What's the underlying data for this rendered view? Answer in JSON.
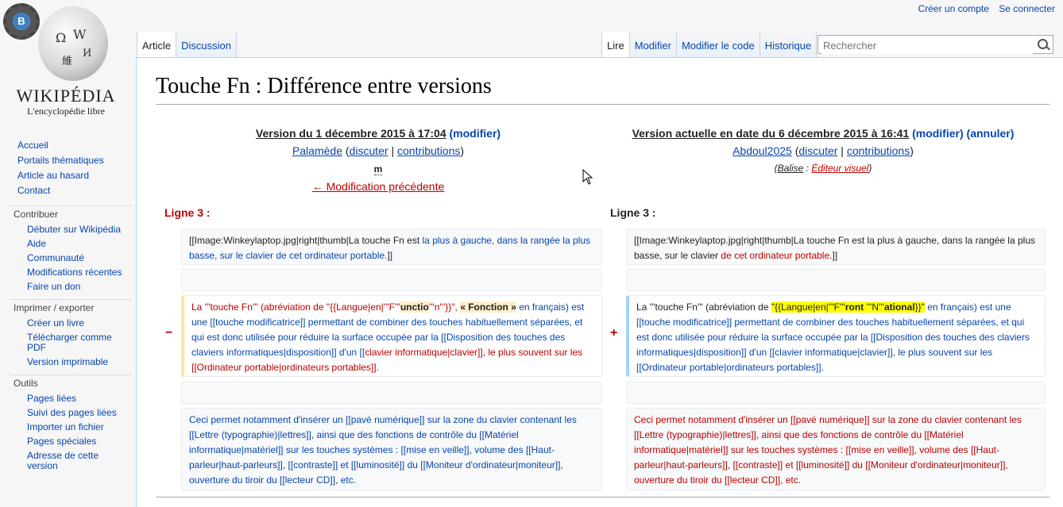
{
  "personal": {
    "create_account": "Créer un compte",
    "login": "Se connecter"
  },
  "logo": {
    "wordmark": "WIKIPÉDIA",
    "tagline": "L'encyclopédie libre",
    "badge_letter": "B"
  },
  "sidebar": {
    "main": [
      "Accueil",
      "Portails thématiques",
      "Article au hasard",
      "Contact"
    ],
    "contribute": {
      "heading": "Contribuer",
      "items": [
        "Débuter sur Wikipédia",
        "Aide",
        "Communauté",
        "Modifications récentes",
        "Faire un don"
      ]
    },
    "print": {
      "heading": "Imprimer / exporter",
      "items": [
        "Créer un livre",
        "Télécharger comme PDF",
        "Version imprimable"
      ]
    },
    "tools": {
      "heading": "Outils",
      "items": [
        "Pages liées",
        "Suivi des pages liées",
        "Importer un fichier",
        "Pages spéciales",
        "Adresse de cette version"
      ]
    }
  },
  "tabs": {
    "article": "Article",
    "discussion": "Discussion",
    "read": "Lire",
    "edit": "Modifier",
    "edit_source": "Modifier le code",
    "history": "Historique"
  },
  "search": {
    "placeholder": "Rechercher"
  },
  "page_title": "Touche Fn : Différence entre versions",
  "left_version": {
    "heading": "Version du 1 décembre 2015 à 17:04",
    "modify": "(modifier)",
    "user": "Palamède",
    "talk": "discuter",
    "contribs": "contributions",
    "minor": "m",
    "prev": "← Modification précédente"
  },
  "right_version": {
    "heading": "Version actuelle en date du 6 décembre 2015 à 16:41",
    "modify": "(modifier)",
    "undo": "(annuler)",
    "user": "Abdoul2025",
    "talk": "discuter",
    "contribs": "contributions",
    "tag_label": "Balise",
    "tag_value": "Éditeur visuel"
  },
  "line_label": "Ligne 3 :",
  "diff": {
    "row1_left_a": "[[Image:Winkeylaptop.jpg|right|thumb|La touche Fn est ",
    "row1_left_b": "la plus à gauche, dans la rangée la plus basse, sur le clavier de cet ordinateur portable.",
    "row1_left_c": "]]",
    "row1_right_a": "[[Image:Winkeylaptop.jpg|right|thumb|La touche Fn est la plus à gauche, dans la rangée la plus basse, sur le clavier ",
    "row1_right_b": "de cet ordinateur portable.",
    "row1_right_c": "]]",
    "row3_left": [
      "La '''touche Fn''' (abréviation de \"{{Langue|en|'''F'''",
      "unctio",
      "'''n'''}}\", ",
      "« Fonction »",
      " en français) est une [[touche modificatrice]] permettant de combiner des touches habituellement séparées, et qui est donc utilisée pour réduire la surface occupée par la [[Disposition des touches des claviers informatiques|disposition]] d'un [[",
      "clavier informatique|clavier",
      "]], le plus souvent sur les [[Ordinateur portable|ordinateurs portables]]."
    ],
    "row3_right": [
      "La '''touche Fn''' (abréviation de ",
      "\"{{Langue|en|'''F'''",
      "ront ",
      "'''N'''",
      "ational",
      "}}\"",
      " en français) est une [[touche modificatrice]] permettant de combiner des touches habituellement séparées, et qui est donc utilisée pour réduire la surface occupée par la [[Disposition des touches des claviers informatiques|disposition]] d'un [[clavier informatique|clavier]], le plus souvent sur les [[Ordinateur portable|ordinateurs portables]]."
    ],
    "row5_left": "Ceci permet notamment d'insérer un [[pavé numérique]] sur la zone du clavier contenant les [[Lettre (typographie)|lettres]], ainsi que des fonctions de contrôle du [[Matériel informatique|matériel]] sur les touches systèmes : [[mise en veille]], volume des [[Haut-parleur|haut-parleurs]], [[contraste]] et [[luminosité]] du [[Moniteur d'ordinateur|moniteur]], ouverture du tiroir du [[lecteur CD]], etc.",
    "row5_right": "Ceci permet notamment d'insérer un [[pavé numérique]] sur la zone du clavier contenant les [[Lettre (typographie)|lettres]], ainsi que des fonctions de contrôle du [[Matériel informatique|matériel]] sur les touches systèmes : [[mise en veille]], volume des [[Haut-parleur|haut-parleurs]], [[contraste]] et [[luminosité]] du [[Moniteur d'ordinateur|moniteur]], ouverture du tiroir du [[lecteur CD]], etc.",
    "minus": "−",
    "plus": "+"
  }
}
